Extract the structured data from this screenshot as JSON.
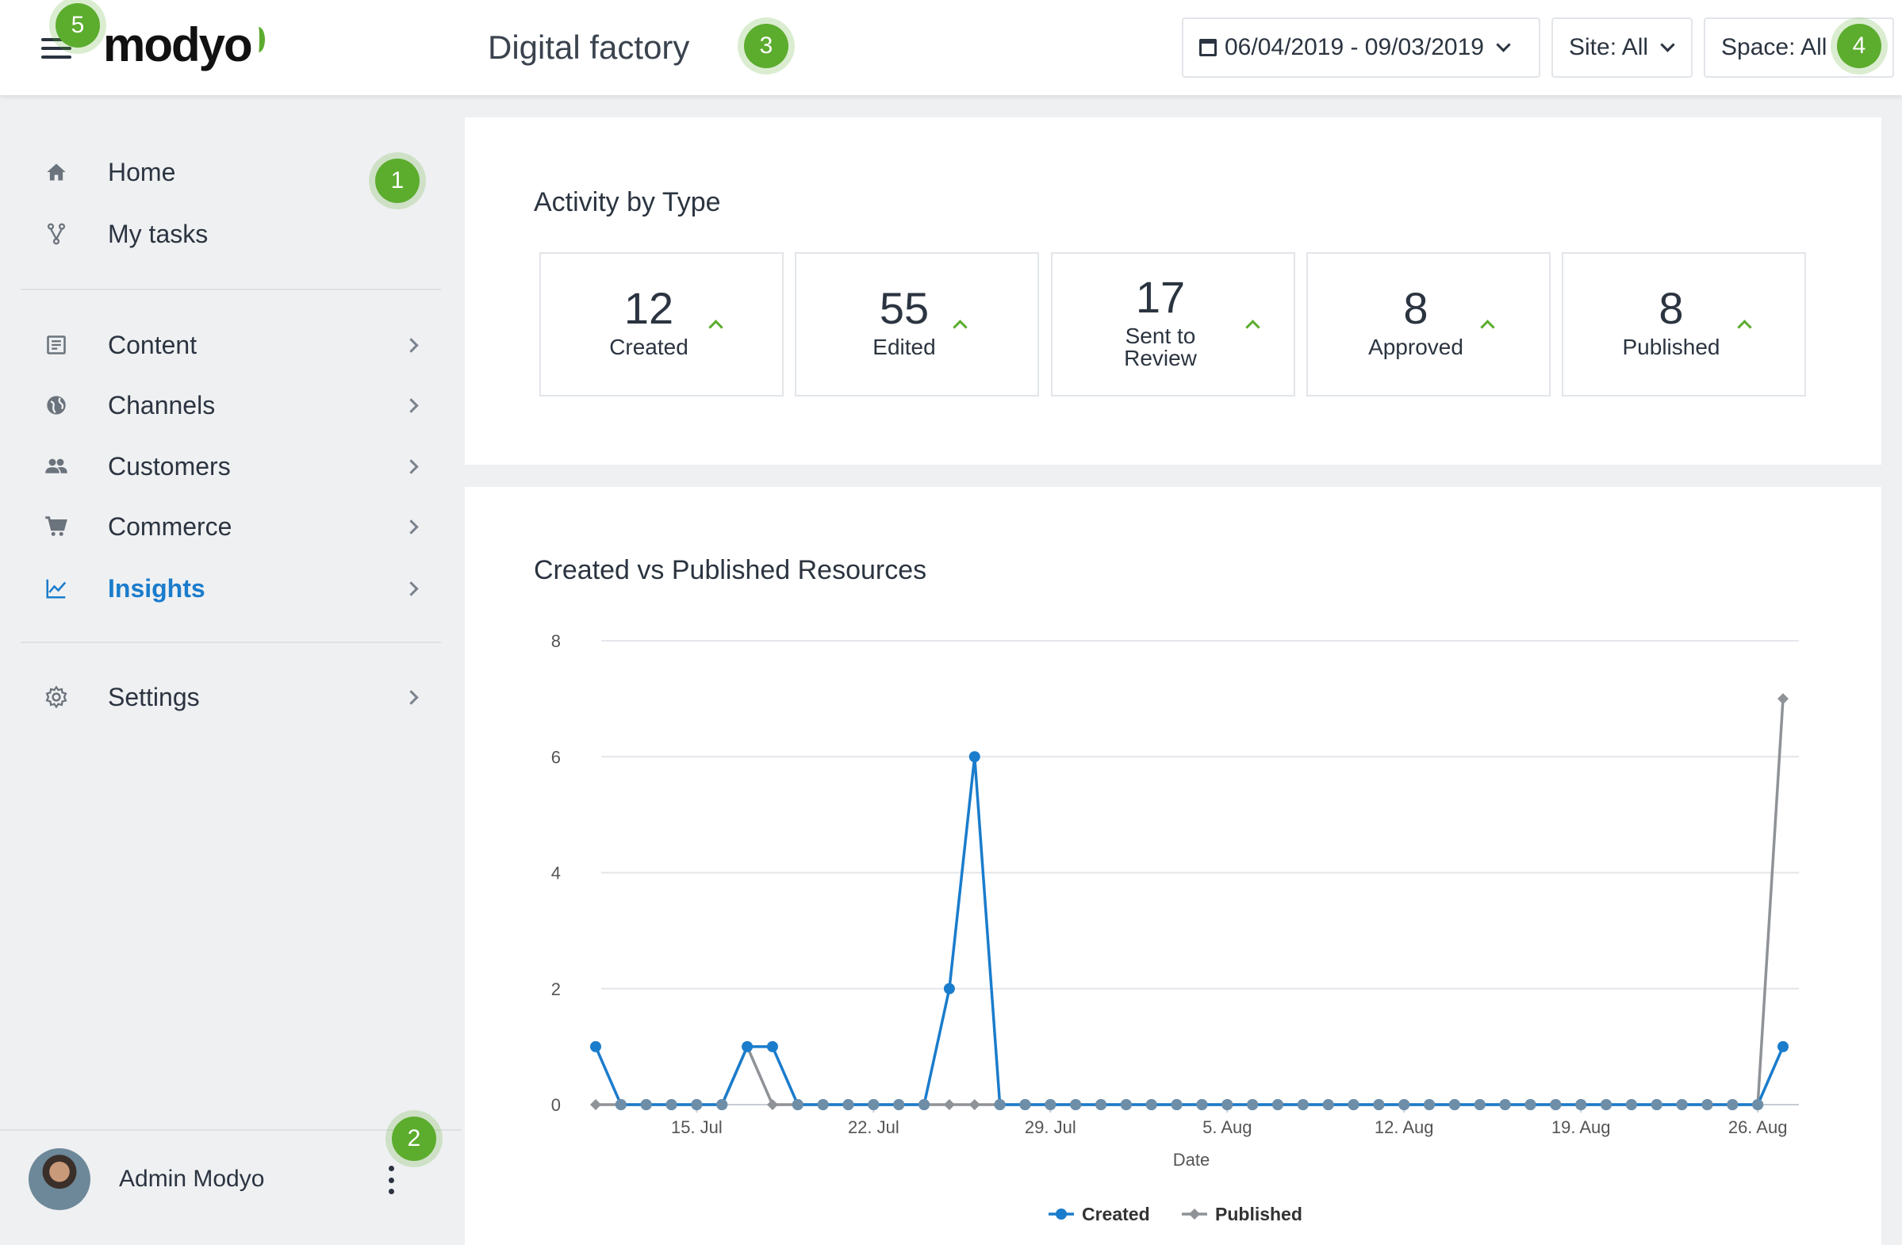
{
  "header": {
    "logo": "modyo",
    "title": "Digital factory",
    "date_range": "06/04/2019 - 09/03/2019",
    "site_filter": "Site: All",
    "space_filter": "Space: All"
  },
  "badges": {
    "b1": "1",
    "b2": "2",
    "b3": "3",
    "b4": "4",
    "b5": "5"
  },
  "sidebar": {
    "items": [
      {
        "label": "Home",
        "icon": "home-icon"
      },
      {
        "label": "My tasks",
        "icon": "fork-icon"
      },
      {
        "label": "Content",
        "icon": "document-icon"
      },
      {
        "label": "Channels",
        "icon": "globe-icon"
      },
      {
        "label": "Customers",
        "icon": "people-icon"
      },
      {
        "label": "Commerce",
        "icon": "cart-icon"
      },
      {
        "label": "Insights",
        "icon": "chart-icon",
        "active": true
      },
      {
        "label": "Settings",
        "icon": "gear-icon"
      }
    ],
    "user": {
      "name": "Admin Modyo"
    }
  },
  "activity": {
    "title": "Activity by Type",
    "stats": [
      {
        "value": "12",
        "label": "Created"
      },
      {
        "value": "55",
        "label": "Edited"
      },
      {
        "value": "17",
        "label": "Sent to Review"
      },
      {
        "value": "8",
        "label": "Approved"
      },
      {
        "value": "8",
        "label": "Published"
      }
    ]
  },
  "colors": {
    "accent": "#1a7ccc",
    "brand": "#5cac2e",
    "published": "#8f9296"
  },
  "chart_data": {
    "type": "line",
    "title": "Created vs Published Resources",
    "xlabel": "Date",
    "ylabel": "",
    "ylim": [
      0,
      8
    ],
    "yticks": [
      0,
      2,
      4,
      6,
      8
    ],
    "x_tick_labels": [
      "15. Jul",
      "22. Jul",
      "29. Jul",
      "5. Aug",
      "12. Aug",
      "19. Aug",
      "26. Aug"
    ],
    "x": [
      "11. Jul",
      "12. Jul",
      "13. Jul",
      "14. Jul",
      "15. Jul",
      "16. Jul",
      "17. Jul",
      "18. Jul",
      "19. Jul",
      "20. Jul",
      "21. Jul",
      "22. Jul",
      "23. Jul",
      "24. Jul",
      "25. Jul",
      "26. Jul",
      "27. Jul",
      "28. Jul",
      "29. Jul",
      "30. Jul",
      "31. Jul",
      "1. Aug",
      "2. Aug",
      "3. Aug",
      "4. Aug",
      "5. Aug",
      "6. Aug",
      "7. Aug",
      "8. Aug",
      "9. Aug",
      "10. Aug",
      "11. Aug",
      "12. Aug",
      "13. Aug",
      "14. Aug",
      "15. Aug",
      "16. Aug",
      "17. Aug",
      "18. Aug",
      "19. Aug",
      "20. Aug",
      "21. Aug",
      "22. Aug",
      "23. Aug",
      "24. Aug",
      "25. Aug",
      "26. Aug",
      "27. Aug"
    ],
    "series": [
      {
        "name": "Created",
        "color": "#1a7ccc",
        "values": [
          1,
          0,
          0,
          0,
          0,
          0,
          1,
          1,
          0,
          0,
          0,
          0,
          0,
          0,
          2,
          6,
          0,
          0,
          0,
          0,
          0,
          0,
          0,
          0,
          0,
          0,
          0,
          0,
          0,
          0,
          0,
          0,
          0,
          0,
          0,
          0,
          0,
          0,
          0,
          0,
          0,
          0,
          0,
          0,
          0,
          0,
          0,
          1
        ]
      },
      {
        "name": "Published",
        "color": "#8f9296",
        "values": [
          0,
          0,
          0,
          0,
          0,
          0,
          1,
          0,
          0,
          0,
          0,
          0,
          0,
          0,
          0,
          0,
          0,
          0,
          0,
          0,
          0,
          0,
          0,
          0,
          0,
          0,
          0,
          0,
          0,
          0,
          0,
          0,
          0,
          0,
          0,
          0,
          0,
          0,
          0,
          0,
          0,
          0,
          0,
          0,
          0,
          0,
          0,
          7
        ]
      }
    ],
    "grid": true,
    "legend": "bottom-center"
  }
}
